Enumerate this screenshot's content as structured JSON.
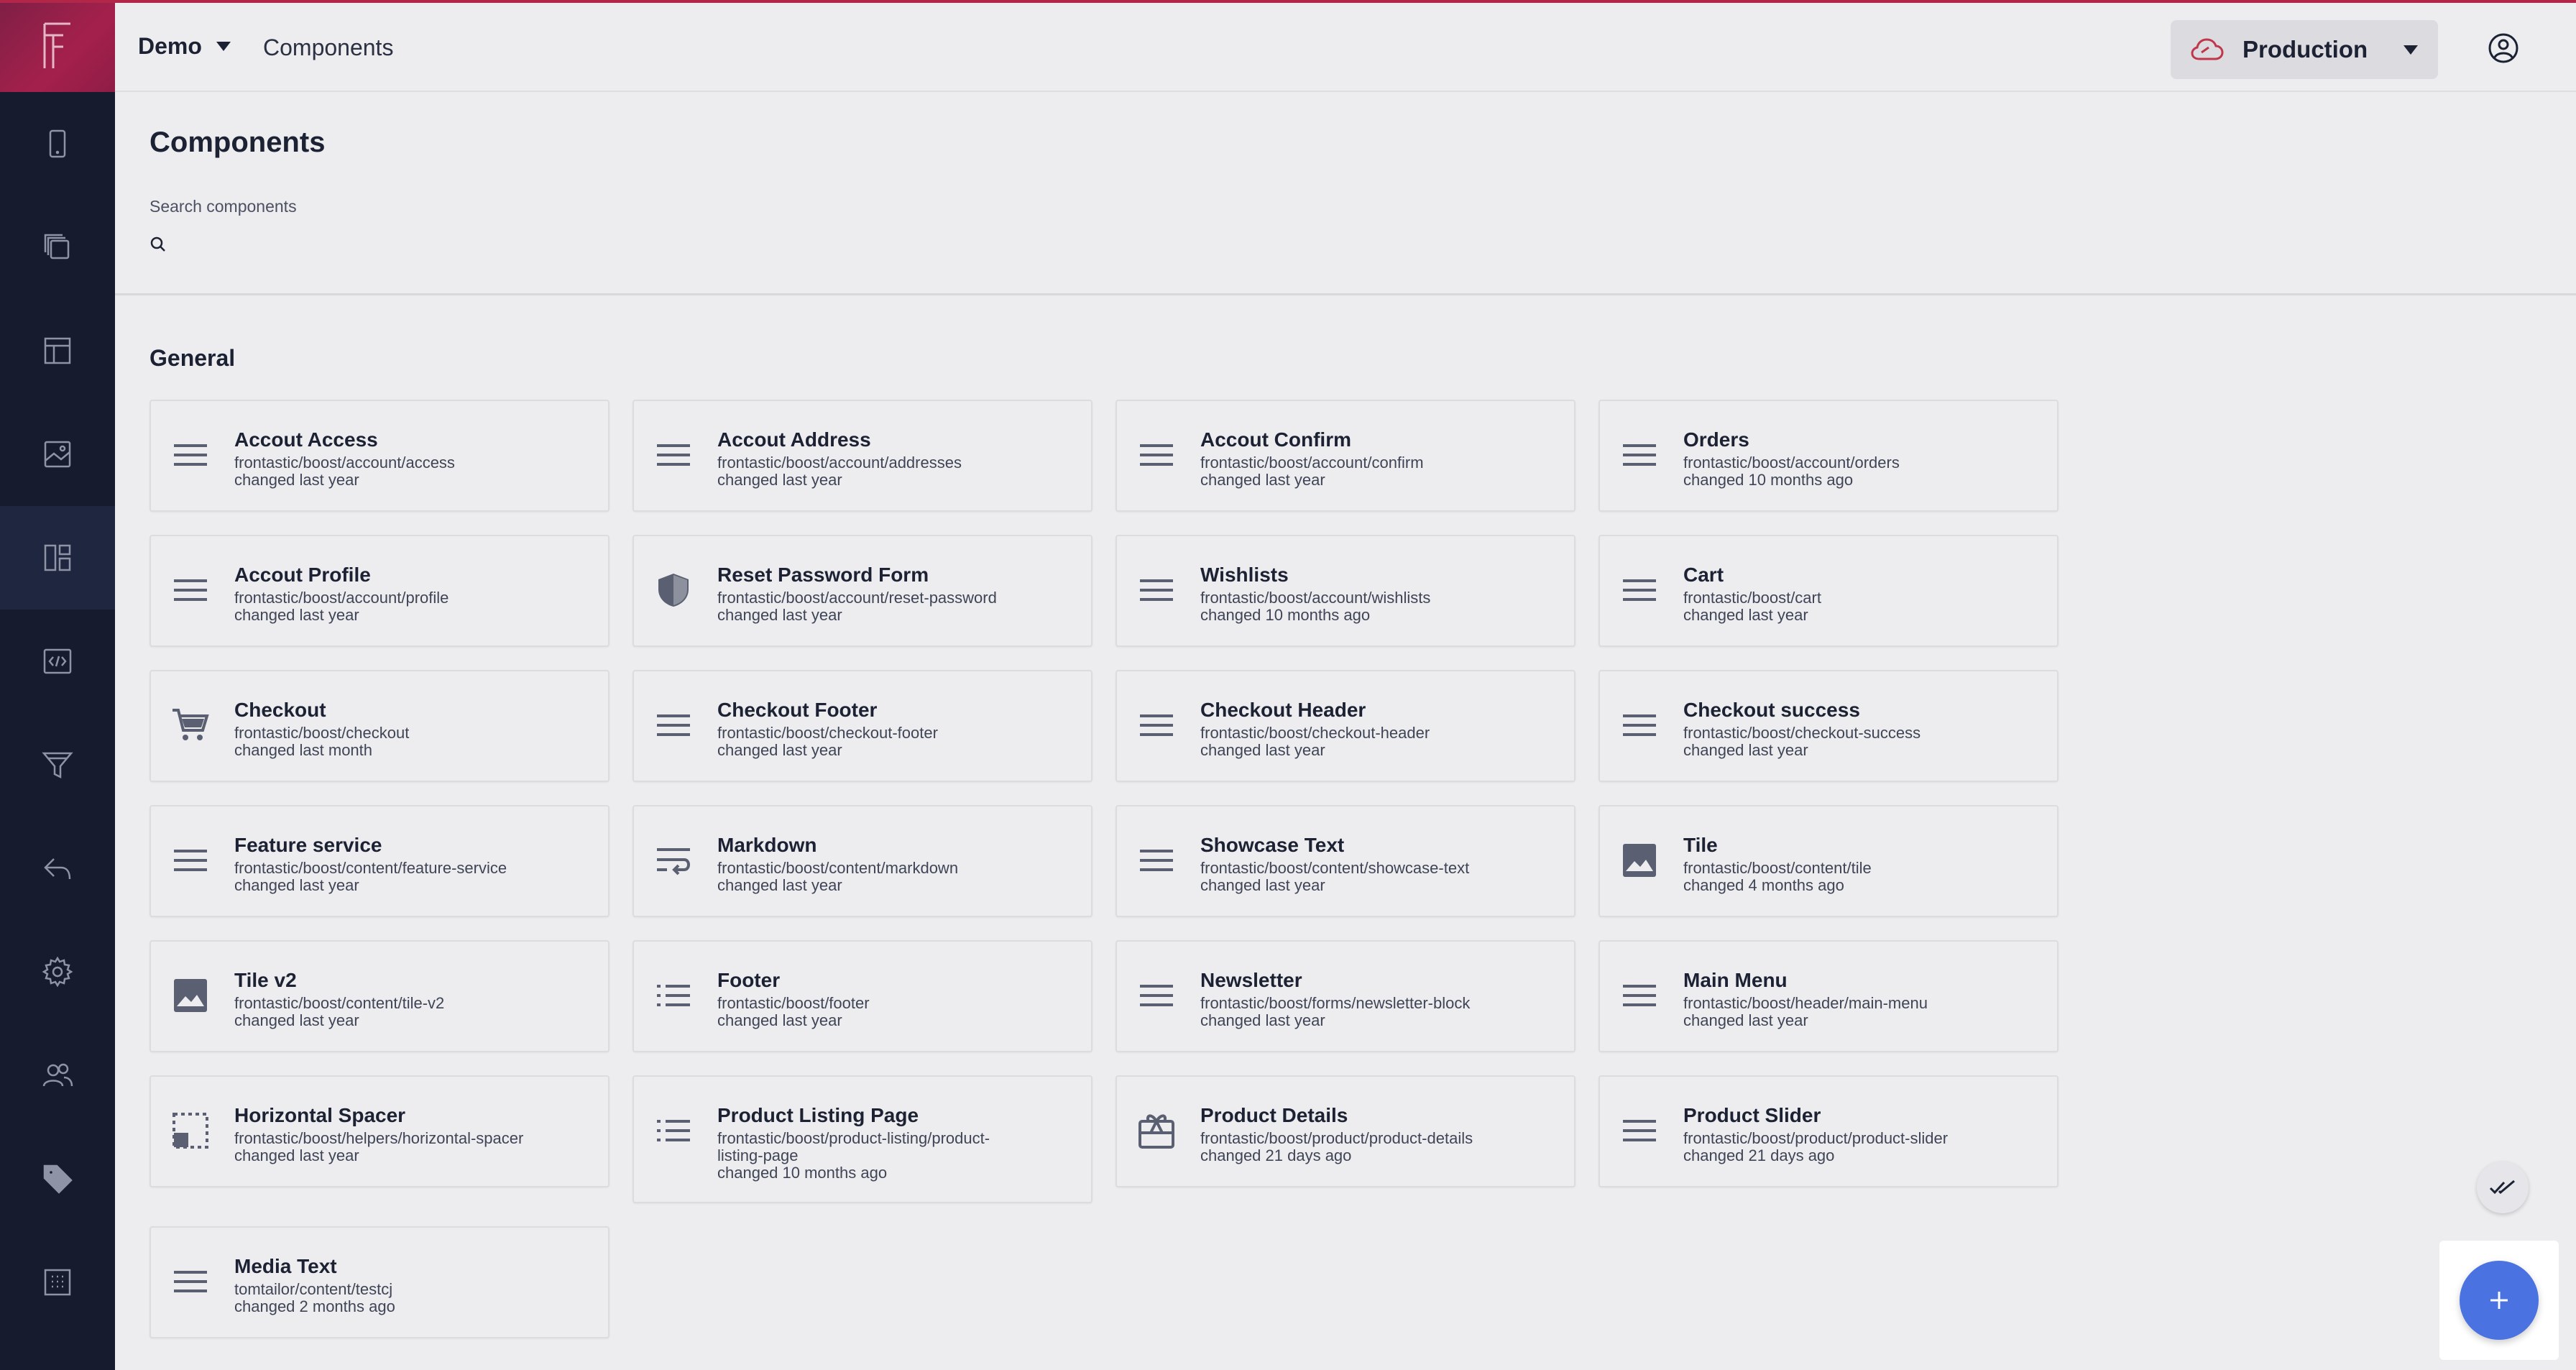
{
  "header": {
    "project": "Demo",
    "breadcrumb": "Components",
    "environment": "Production"
  },
  "sidebar": {
    "items": [
      {
        "icon": "mobile-icon"
      },
      {
        "icon": "pages-icon"
      },
      {
        "icon": "layout-icon"
      },
      {
        "icon": "media-icon"
      },
      {
        "icon": "components-icon",
        "active": true
      },
      {
        "icon": "code-icon"
      },
      {
        "icon": "filter-icon"
      },
      {
        "icon": "redirect-icon"
      },
      {
        "icon": "settings-icon"
      },
      {
        "icon": "users-icon"
      },
      {
        "icon": "tag-icon"
      },
      {
        "icon": "grid-icon"
      }
    ]
  },
  "page": {
    "title": "Components",
    "search_label": "Search components",
    "search_value": "",
    "section": "General"
  },
  "components": [
    {
      "title": "Accout Access",
      "path": "frontastic/boost/account/access",
      "changed": "changed last year",
      "icon": "menu-icon"
    },
    {
      "title": "Accout Address",
      "path": "frontastic/boost/account/addresses",
      "changed": "changed last year",
      "icon": "menu-icon"
    },
    {
      "title": "Accout Confirm",
      "path": "frontastic/boost/account/confirm",
      "changed": "changed last year",
      "icon": "menu-icon"
    },
    {
      "title": "Orders",
      "path": "frontastic/boost/account/orders",
      "changed": "changed 10 months ago",
      "icon": "menu-icon"
    },
    {
      "title": "Accout Profile",
      "path": "frontastic/boost/account/profile",
      "changed": "changed last year",
      "icon": "menu-icon"
    },
    {
      "title": "Reset Password Form",
      "path": "frontastic/boost/account/reset-password",
      "changed": "changed last year",
      "icon": "shield-icon"
    },
    {
      "title": "Wishlists",
      "path": "frontastic/boost/account/wishlists",
      "changed": "changed 10 months ago",
      "icon": "menu-icon"
    },
    {
      "title": "Cart",
      "path": "frontastic/boost/cart",
      "changed": "changed last year",
      "icon": "menu-icon"
    },
    {
      "title": "Checkout",
      "path": "frontastic/boost/checkout",
      "changed": "changed last month",
      "icon": "cart-icon"
    },
    {
      "title": "Checkout Footer",
      "path": "frontastic/boost/checkout-footer",
      "changed": "changed last year",
      "icon": "menu-icon"
    },
    {
      "title": "Checkout Header",
      "path": "frontastic/boost/checkout-header",
      "changed": "changed last year",
      "icon": "menu-icon"
    },
    {
      "title": "Checkout success",
      "path": "frontastic/boost/checkout-success",
      "changed": "changed last year",
      "icon": "menu-icon"
    },
    {
      "title": "Feature service",
      "path": "frontastic/boost/content/feature-service",
      "changed": "changed last year",
      "icon": "menu-icon"
    },
    {
      "title": "Markdown",
      "path": "frontastic/boost/content/markdown",
      "changed": "changed last year",
      "icon": "wrap-text-icon"
    },
    {
      "title": "Showcase Text",
      "path": "frontastic/boost/content/showcase-text",
      "changed": "changed last year",
      "icon": "menu-icon"
    },
    {
      "title": "Tile",
      "path": "frontastic/boost/content/tile",
      "changed": "changed 4 months ago",
      "icon": "image-icon"
    },
    {
      "title": "Tile v2",
      "path": "frontastic/boost/content/tile-v2",
      "changed": "changed last year",
      "icon": "image-icon"
    },
    {
      "title": "Footer",
      "path": "frontastic/boost/footer",
      "changed": "changed last year",
      "icon": "list-icon"
    },
    {
      "title": "Newsletter",
      "path": "frontastic/boost/forms/newsletter-block",
      "changed": "changed last year",
      "icon": "menu-icon"
    },
    {
      "title": "Main Menu",
      "path": "frontastic/boost/header/main-menu",
      "changed": "changed last year",
      "icon": "menu-icon"
    },
    {
      "title": "Horizontal Spacer",
      "path": "frontastic/boost/helpers/horizontal-spacer",
      "changed": "changed last year",
      "icon": "spacer-icon"
    },
    {
      "title": "Product Listing Page",
      "path": "frontastic/boost/product-listing/product-listing-page",
      "changed": "changed 10 months ago",
      "icon": "list-icon"
    },
    {
      "title": "Product Details",
      "path": "frontastic/boost/product/product-details",
      "changed": "changed 21 days ago",
      "icon": "gift-card-icon"
    },
    {
      "title": "Product Slider",
      "path": "frontastic/boost/product/product-slider",
      "changed": "changed 21 days ago",
      "icon": "menu-icon"
    },
    {
      "title": "Media Text",
      "path": "tomtailor/content/testcj",
      "changed": "changed 2 months ago",
      "icon": "menu-icon"
    }
  ],
  "colors": {
    "sidebar": "#171b2e",
    "brand": "#a4204c",
    "accent": "#4a72e0"
  }
}
